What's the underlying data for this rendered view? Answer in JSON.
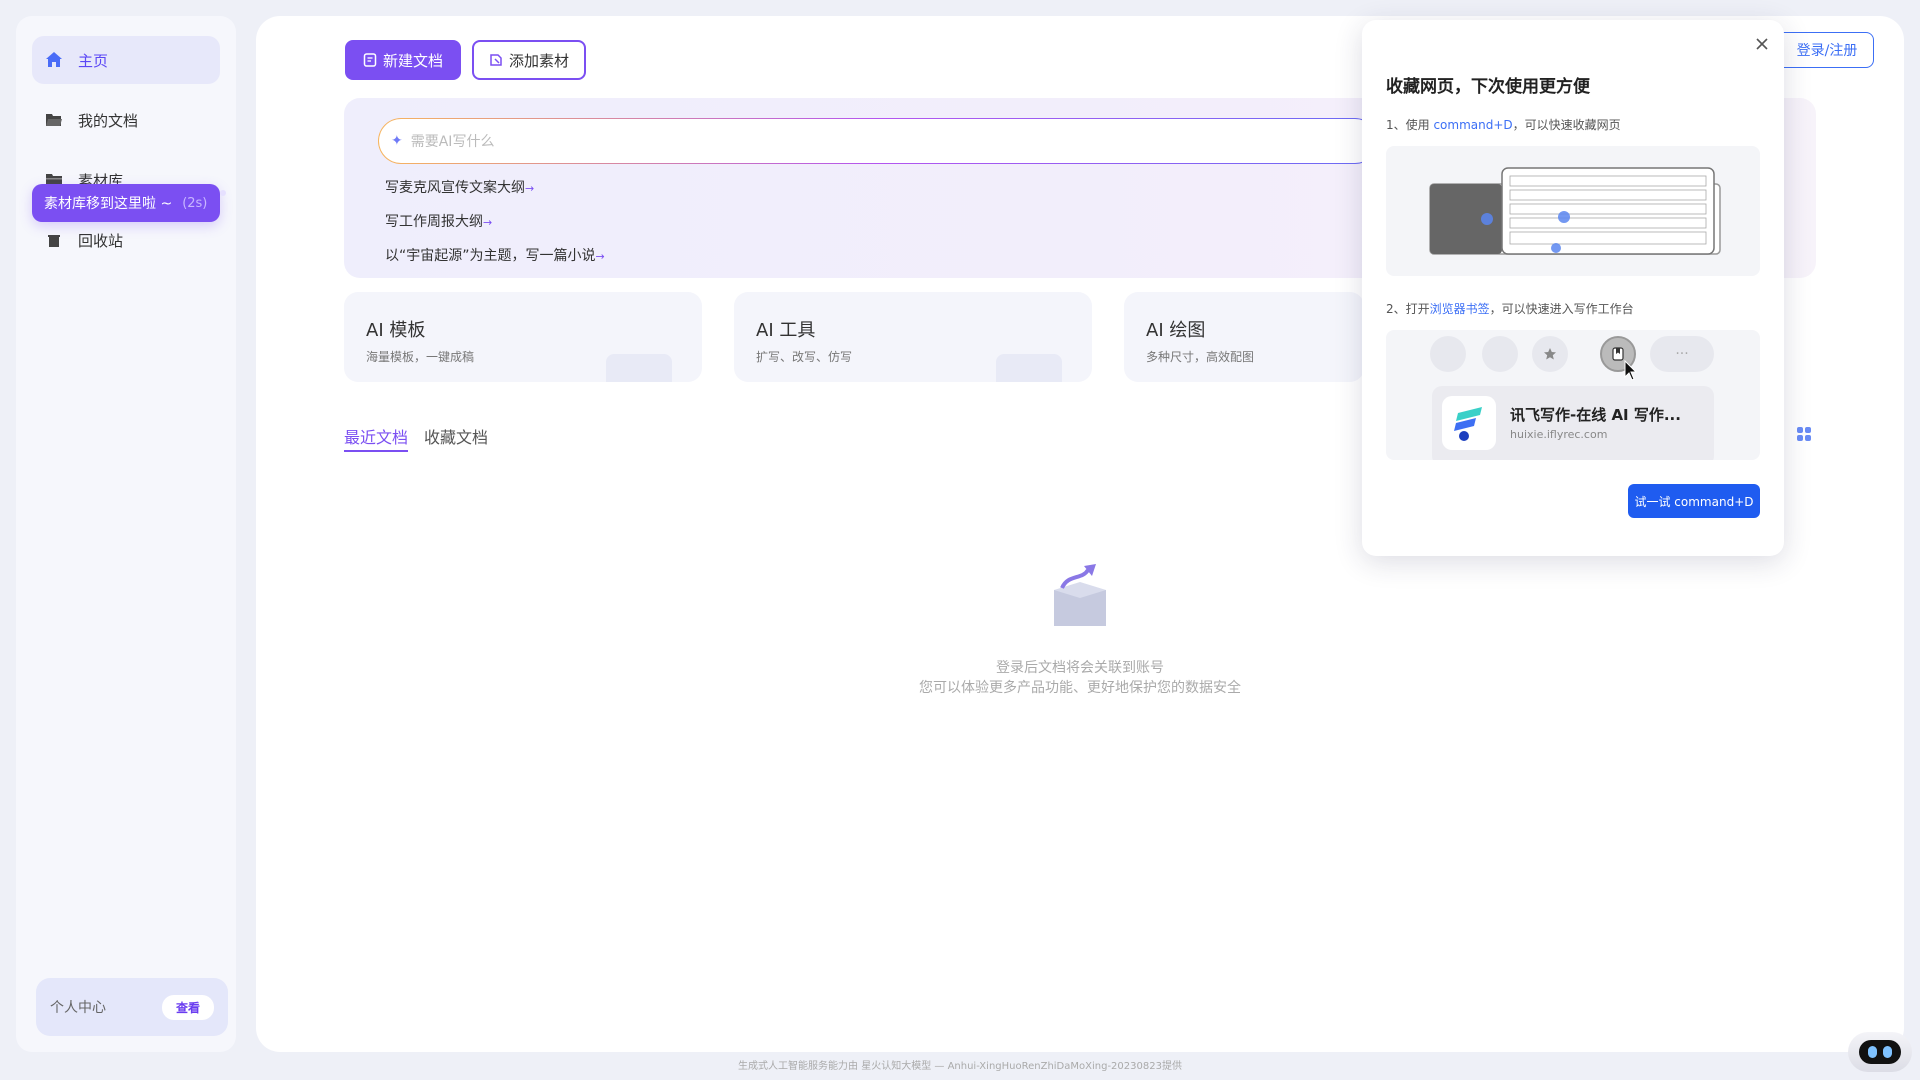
{
  "sidebar": {
    "items": [
      {
        "label": "主页",
        "icon": "home-icon",
        "active": true
      },
      {
        "label": "我的文档",
        "icon": "folder-open-icon",
        "active": false
      },
      {
        "label": "素材库",
        "icon": "folder-icon",
        "active": false
      },
      {
        "label": "回收站",
        "icon": "trash-icon",
        "active": false
      }
    ],
    "tooltip": {
      "text": "素材库移到这里啦 ~",
      "countdown": "(2s)"
    },
    "profile": {
      "label": "个人中心",
      "button": "查看"
    }
  },
  "toolbar": {
    "new_doc": "新建文档",
    "add_material": "添加素材"
  },
  "ai": {
    "placeholder": "需要AI写什么",
    "suggestions": [
      "写麦克风宣传文案大纲",
      "写工作周报大纲",
      "以“宇宙起源”为主题，写一篇小说"
    ]
  },
  "features": [
    {
      "title": "AI 模板",
      "subtitle": "海量模板，一键成稿"
    },
    {
      "title": "AI 工具",
      "subtitle": "扩写、改写、仿写"
    },
    {
      "title": "AI 绘图",
      "subtitle": "多种尺寸，高效配图"
    }
  ],
  "tabs": {
    "recent": "最近文档",
    "favorites": "收藏文档"
  },
  "empty": {
    "line1": "登录后文档将会关联到账号",
    "line2": "您可以体验更多产品功能、更好地保护您的数据安全"
  },
  "popup": {
    "title": "收藏网页，下次使用更方便",
    "step1_prefix": "1、使用 ",
    "step1_key": "command+D",
    "step1_suffix": "，可以快速收藏网页",
    "step2_prefix": "2、打开",
    "step2_link": "浏览器书签",
    "step2_suffix": "，可以快速进入写作工作台",
    "site_name": "讯飞写作-在线 AI 写作...",
    "site_url": "huixie.iflyrec.com",
    "try_button": "试一试 command+D"
  },
  "header": {
    "login": "登录/注册"
  },
  "footer": "生成式人工智能服务能力由 星火认知大模型 — Anhui-XingHuoRenZhiDaMoXing-20230823提供",
  "colors": {
    "accent": "#7b4ff2",
    "link": "#3c6ff5",
    "primary_button": "#1f5cf0"
  }
}
